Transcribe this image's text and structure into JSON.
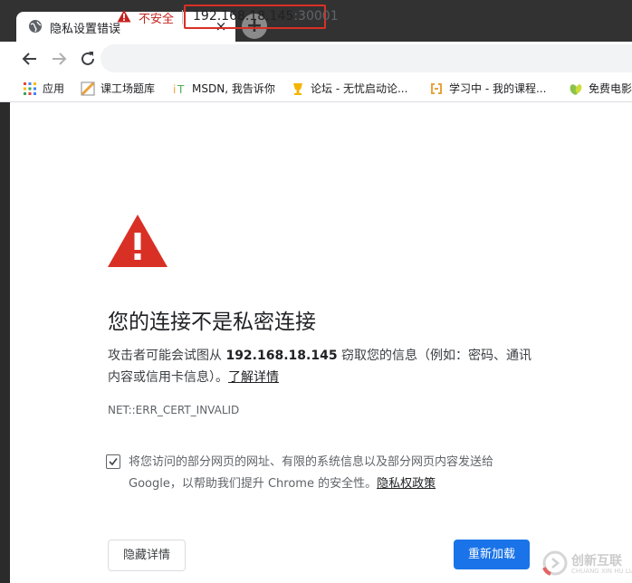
{
  "tab": {
    "title": "隐私设置错误",
    "close": "×"
  },
  "new_tab": "+",
  "omnibox": {
    "security_label": "不安全",
    "url_host": "192.168.18.145",
    "url_port": ":30001"
  },
  "bookmarks": [
    {
      "label": "应用",
      "icon": "apps-grid-icon"
    },
    {
      "label": "课工场题库",
      "icon": "bookmark-favicon"
    },
    {
      "label": "MSDN, 我告诉你",
      "icon": "msdn-favicon"
    },
    {
      "label": "论坛 - 无忧启动论...",
      "icon": "forum-favicon"
    },
    {
      "label": "学习中 - 我的课程...",
      "icon": "course-favicon"
    },
    {
      "label": "免费电影",
      "icon": "leaf-favicon"
    }
  ],
  "interstitial": {
    "heading": "您的连接不是私密连接",
    "para_prefix": "攻击者可能会试图从 ",
    "para_host": "192.168.18.145",
    "para_suffix": " 窃取您的信息（例如：密码、通讯内容或信用卡信息）。",
    "learn_more": "了解详情",
    "error_code": "NET::ERR_CERT_INVALID",
    "checkbox_text": "将您访问的部分网页的网址、有限的系统信息以及部分网页内容发送给 Google，以帮助我们提升 Chrome 的安全性。",
    "privacy_link": "隐私权政策",
    "hide_details_button": "隐藏详情",
    "reload_button": "重新加载"
  },
  "watermark": {
    "text": "创新互联",
    "sub": "CHUANG XIN HU LIAN"
  },
  "colors": {
    "warning_red": "#d93025",
    "button_blue": "#1a73e8"
  }
}
